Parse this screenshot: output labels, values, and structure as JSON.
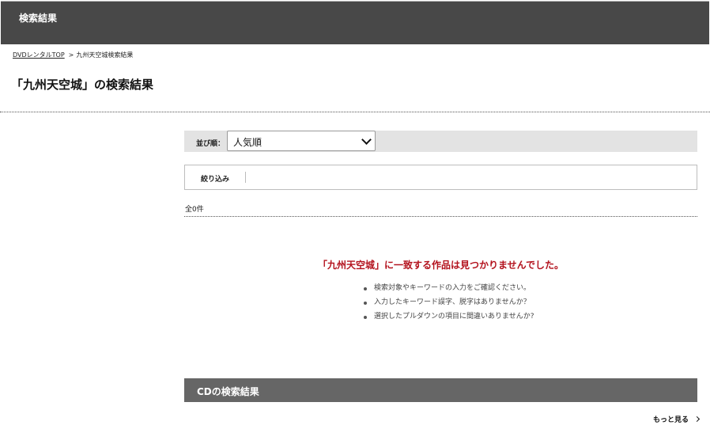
{
  "header": {
    "title": "検索結果"
  },
  "breadcrumb": {
    "home_link": "DVDレンタルTOP",
    "separator": ">",
    "current": "九州天空城検索結果"
  },
  "page_heading": "「九州天空城」の検索結果",
  "sort": {
    "label": "並び順：",
    "selected": "人気順"
  },
  "filter": {
    "label": "絞り込み"
  },
  "result_count": "全0件",
  "no_result_message": "「九州天空城」に一致する作品は見つかりませんでした。",
  "hints": [
    "検索対象やキーワードの入力をご確認ください。",
    "入力したキーワード誤字、脱字はありませんか？",
    "選択したプルダウンの項目に間違いありませんか?"
  ],
  "cd_section": {
    "title": "CDの検索結果",
    "more_label": "もっと見る"
  },
  "colors": {
    "header_bg": "#484848",
    "cd_bar_bg": "#666666",
    "error_text": "#b3121d",
    "sort_bar_bg": "#e3e3e3"
  },
  "icons": {
    "select_arrow": "chevron-down-icon",
    "more_arrow": "chevron-right-icon"
  }
}
